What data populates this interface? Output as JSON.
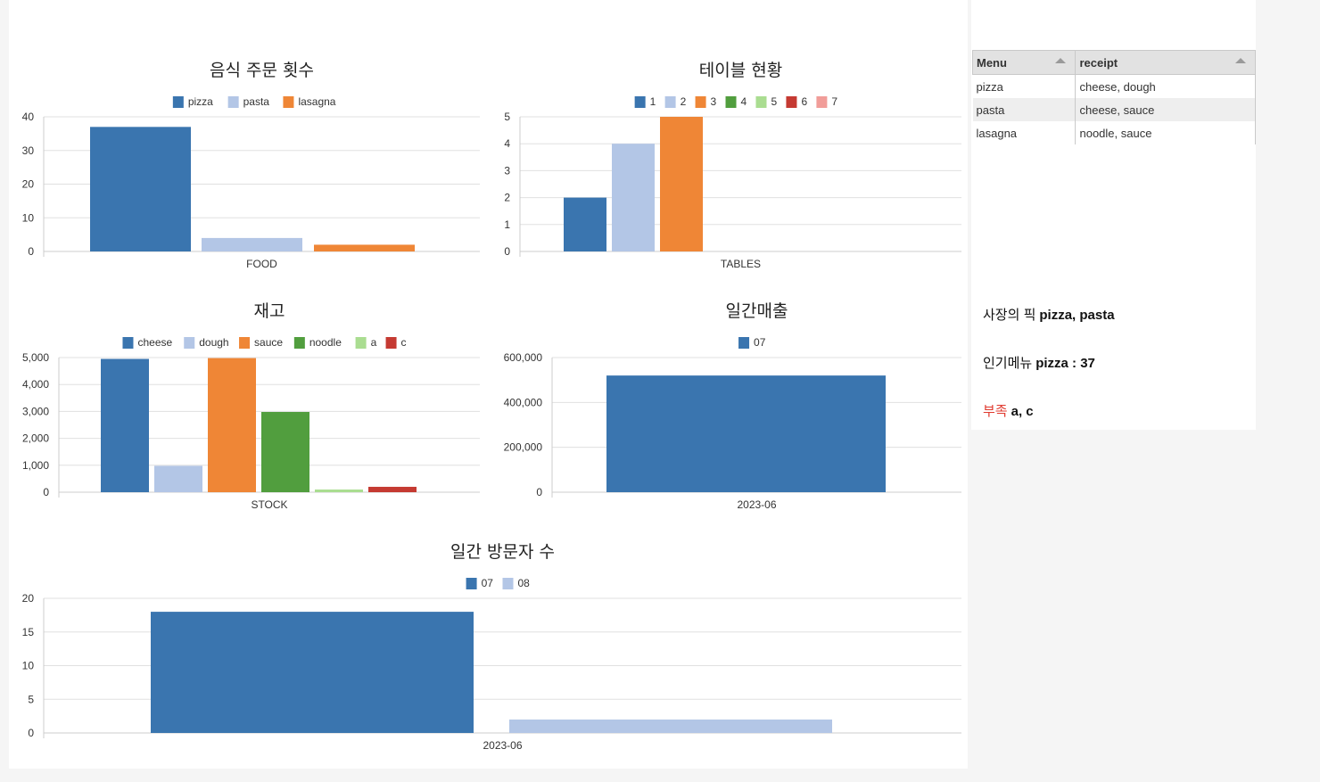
{
  "colors": {
    "palette": [
      "#3a75af",
      "#b3c6e6",
      "#ef8636",
      "#519e3e",
      "#aadd91",
      "#c53a32",
      "#f19d99"
    ],
    "grid": "#e0e0e0",
    "axis": "#cccccc"
  },
  "chart_data": [
    {
      "type": "bar",
      "title": "음식 주문 횟수",
      "categories": [
        "FOOD"
      ],
      "series": [
        {
          "name": "pizza",
          "values": [
            37
          ]
        },
        {
          "name": "pasta",
          "values": [
            4
          ]
        },
        {
          "name": "lasagna",
          "values": [
            2
          ]
        }
      ],
      "ylim": [
        0,
        40
      ],
      "yticks": [
        "0",
        "10",
        "20",
        "30",
        "40"
      ],
      "grid": true,
      "legend": "top-center"
    },
    {
      "type": "bar",
      "title": "테이블 현황",
      "categories": [
        "TABLES"
      ],
      "series": [
        {
          "name": "1",
          "values": [
            2
          ]
        },
        {
          "name": "2",
          "values": [
            4
          ]
        },
        {
          "name": "3",
          "values": [
            5
          ]
        },
        {
          "name": "4",
          "values": [
            0
          ]
        },
        {
          "name": "5",
          "values": [
            0
          ]
        },
        {
          "name": "6",
          "values": [
            0
          ]
        },
        {
          "name": "7",
          "values": [
            0
          ]
        }
      ],
      "ylim": [
        0,
        5
      ],
      "yticks": [
        "0",
        "1",
        "2",
        "3",
        "4",
        "5"
      ],
      "grid": true,
      "legend": "top-center"
    },
    {
      "type": "bar",
      "title": "재고",
      "categories": [
        "STOCK"
      ],
      "series": [
        {
          "name": "cheese",
          "values": [
            4950
          ]
        },
        {
          "name": "dough",
          "values": [
            980
          ]
        },
        {
          "name": "sauce",
          "values": [
            4980
          ]
        },
        {
          "name": "noodle",
          "values": [
            2980
          ]
        },
        {
          "name": "a",
          "values": [
            100
          ]
        },
        {
          "name": "c",
          "values": [
            200
          ]
        }
      ],
      "ylim": [
        0,
        5000
      ],
      "yticks": [
        "0",
        "1,000",
        "2,000",
        "3,000",
        "4,000",
        "5,000"
      ],
      "grid": true,
      "legend": "top-center"
    },
    {
      "type": "bar",
      "title": "일간매출",
      "categories": [
        "2023-06"
      ],
      "series": [
        {
          "name": "07",
          "values": [
            520000
          ]
        }
      ],
      "ylim": [
        0,
        600000
      ],
      "yticks": [
        "0",
        "200,000",
        "400,000",
        "600,000"
      ],
      "grid": true,
      "legend": "top-center"
    },
    {
      "type": "bar",
      "title": "일간 방문자 수",
      "categories": [
        "2023-06"
      ],
      "series": [
        {
          "name": "07",
          "values": [
            18
          ]
        },
        {
          "name": "08",
          "values": [
            2
          ]
        }
      ],
      "ylim": [
        0,
        20
      ],
      "yticks": [
        "0",
        "5",
        "10",
        "15",
        "20"
      ],
      "grid": true,
      "legend": "top-center"
    }
  ],
  "menu_table": {
    "headers": [
      "Menu",
      "receipt"
    ],
    "rows": [
      [
        "pizza",
        "cheese, dough"
      ],
      [
        "pasta",
        "cheese, sauce"
      ],
      [
        "lasagna",
        "noodle, sauce"
      ]
    ]
  },
  "info": {
    "owner_pick_label": "사장의 픽",
    "owner_pick_value": "pizza, pasta",
    "popular_label": "인기메뉴",
    "popular_value": "pizza : 37",
    "shortage_label": "부족",
    "shortage_value": "a, c"
  }
}
